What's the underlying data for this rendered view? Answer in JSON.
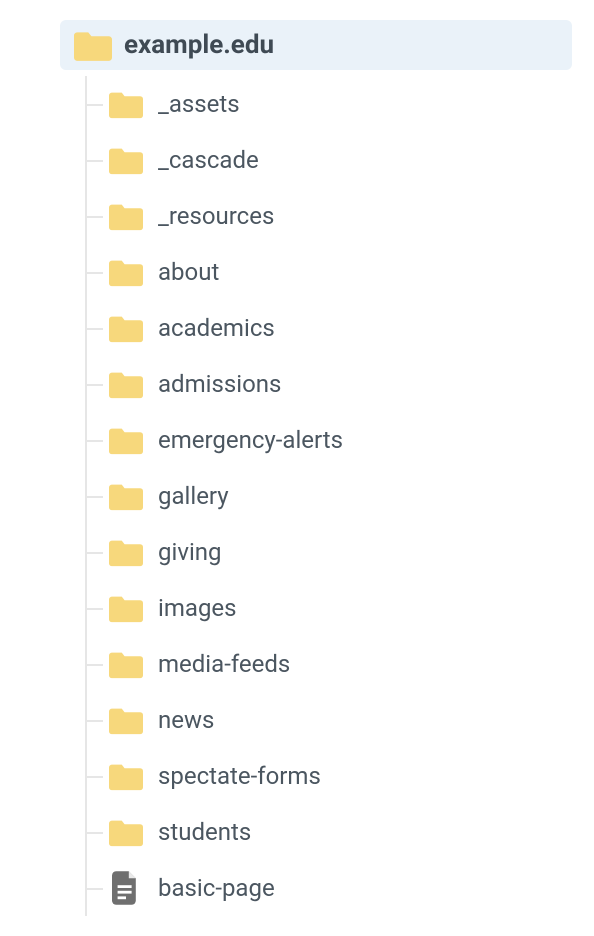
{
  "tree": {
    "root": {
      "type": "folder",
      "label": "example.edu",
      "selected": true
    },
    "children": [
      {
        "type": "folder",
        "label": "_assets"
      },
      {
        "type": "folder",
        "label": "_cascade"
      },
      {
        "type": "folder",
        "label": "_resources"
      },
      {
        "type": "folder",
        "label": "about"
      },
      {
        "type": "folder",
        "label": "academics"
      },
      {
        "type": "folder",
        "label": "admissions"
      },
      {
        "type": "folder",
        "label": "emergency-alerts"
      },
      {
        "type": "folder",
        "label": "gallery"
      },
      {
        "type": "folder",
        "label": "giving"
      },
      {
        "type": "folder",
        "label": "images"
      },
      {
        "type": "folder",
        "label": "media-feeds"
      },
      {
        "type": "folder",
        "label": "news"
      },
      {
        "type": "folder",
        "label": "spectate-forms"
      },
      {
        "type": "folder",
        "label": "students"
      },
      {
        "type": "file",
        "label": "basic-page"
      }
    ]
  },
  "colors": {
    "folder_fill": "#f7d87c",
    "file_fill": "#6f6f6f",
    "selected_bg": "#eaf2f9",
    "text": "#4b5660",
    "text_bold": "#3f4a54",
    "connector": "#e6e6e6"
  }
}
